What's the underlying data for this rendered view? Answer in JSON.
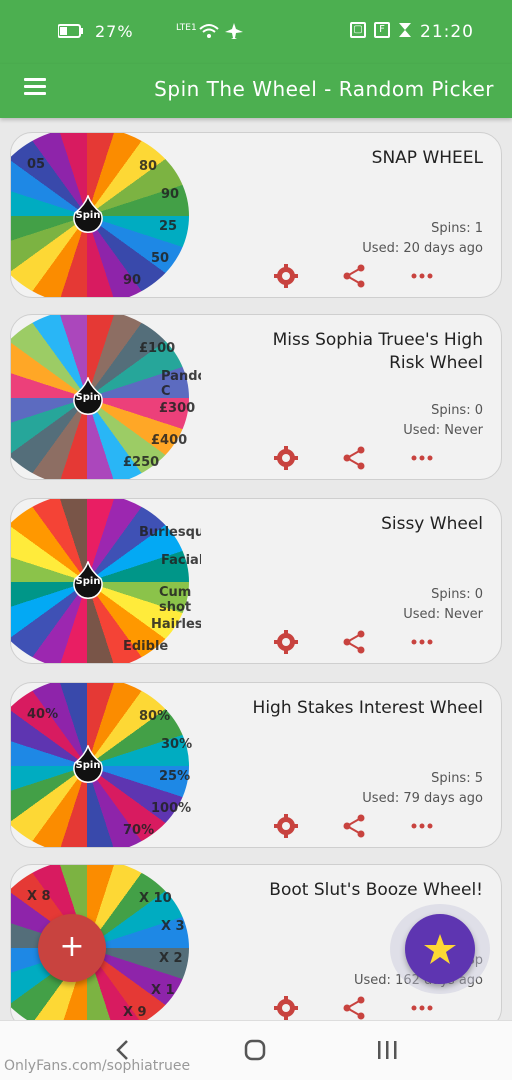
{
  "status_bar": {
    "time": "21:20",
    "battery": "27%",
    "network": "LTE1",
    "icons": [
      "hourglass-icon",
      "flipboard-icon",
      "square-app-icon",
      "wifi-icon",
      "airplane-icon"
    ]
  },
  "app_bar": {
    "title": "Spin The Wheel - Random Picker",
    "menu_icon": "hamburger-menu-icon"
  },
  "wheel_center_label": "Spin",
  "cards": [
    {
      "title": "SNAP WHEEL",
      "spins": "Spins: 1",
      "used": "Used: 20 days ago",
      "wheel_labels": [
        "90",
        "25",
        "50",
        "80",
        "90",
        "05"
      ],
      "colors": [
        "#e53935",
        "#fb8c00",
        "#fdd835",
        "#7cb342",
        "#43a047",
        "#00acc1",
        "#1e88e5",
        "#3949ab",
        "#8e24aa",
        "#d81b60"
      ]
    },
    {
      "title": "Miss Sophia Truee's High Risk Wheel",
      "spins": "Spins: 0",
      "used": "Used: Never",
      "wheel_labels": [
        "Pandora C",
        "£300",
        "£400",
        "£100",
        "£250"
      ],
      "colors": [
        "#e53935",
        "#8d6e63",
        "#546e7a",
        "#26a69a",
        "#5c6bc0",
        "#ec407a",
        "#ffa726",
        "#9ccc65",
        "#29b6f6",
        "#ab47bc"
      ]
    },
    {
      "title": "Sissy Wheel",
      "spins": "Spins: 0",
      "used": "Used: Never",
      "wheel_labels": [
        "Facial!",
        "Cum shot",
        "Hairless!",
        "Burlesque",
        "Edible"
      ],
      "colors": [
        "#e91e63",
        "#9c27b0",
        "#3f51b5",
        "#03a9f4",
        "#009688",
        "#8bc34a",
        "#ffeb3b",
        "#ff9800",
        "#f44336",
        "#795548"
      ]
    },
    {
      "title": "High Stakes Interest Wheel",
      "spins": "Spins: 5",
      "used": "Used: 79 days ago",
      "wheel_labels": [
        "30%",
        "25%",
        "100%",
        "80%",
        "70%",
        "40%"
      ],
      "colors": [
        "#e53935",
        "#fb8c00",
        "#fdd835",
        "#43a047",
        "#00acc1",
        "#1e88e5",
        "#5e35b1",
        "#d81b60",
        "#8e24aa",
        "#3949ab"
      ]
    },
    {
      "title": "Boot Slut's Booze Wheel!",
      "spins": "Sp",
      "used": "Used: 162 days ago",
      "wheel_labels": [
        "X 3",
        "X 2",
        "X 1",
        "X 10",
        "X 9",
        "X 8"
      ],
      "colors": [
        "#fb8c00",
        "#fdd835",
        "#43a047",
        "#00acc1",
        "#1e88e5",
        "#546e7a",
        "#8e24aa",
        "#e53935",
        "#d81b60",
        "#7cb342"
      ]
    }
  ],
  "fab_add_label": "+",
  "nav": {
    "back": "back-icon",
    "home": "home-icon",
    "recents": "recents-icon"
  },
  "watermark": "OnlyFans.com/sophiatruee",
  "colors": {
    "primary": "#4caf50",
    "action_red": "#c8433f",
    "fab_purple": "#5e35b1",
    "star_yellow": "#fdd835"
  }
}
